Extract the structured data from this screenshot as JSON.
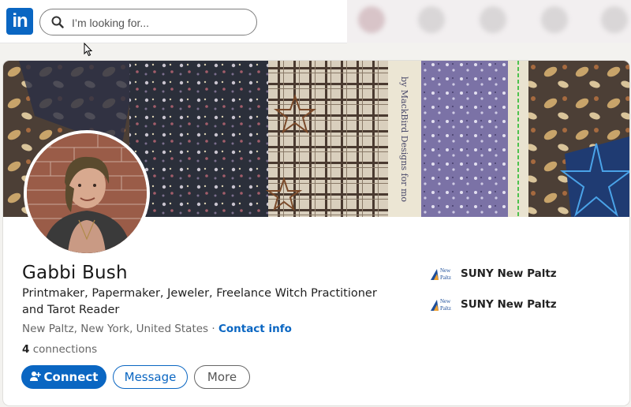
{
  "topbar": {
    "logo_text": "in",
    "search_placeholder": "I’m looking for..."
  },
  "profile": {
    "name": "Gabbi Bush",
    "headline": "Printmaker, Papermaker, Jeweler, Freelance Witch Practitioner and Tarot Reader",
    "location": "New Paltz, New York, United States",
    "separator": " · ",
    "contact_info": "Contact info",
    "connections_count": "4",
    "connections_label": " connections"
  },
  "actions": {
    "connect": "Connect",
    "message": "Message",
    "more": "More"
  },
  "education": [
    {
      "logo_line1": "New",
      "logo_line2": "Paltz",
      "name": "SUNY New Paltz"
    },
    {
      "logo_line1": "New",
      "logo_line2": "Paltz",
      "name": "SUNY New Paltz"
    }
  ],
  "colors": {
    "brand": "#0a66c2",
    "background": "#f3f2ef"
  }
}
